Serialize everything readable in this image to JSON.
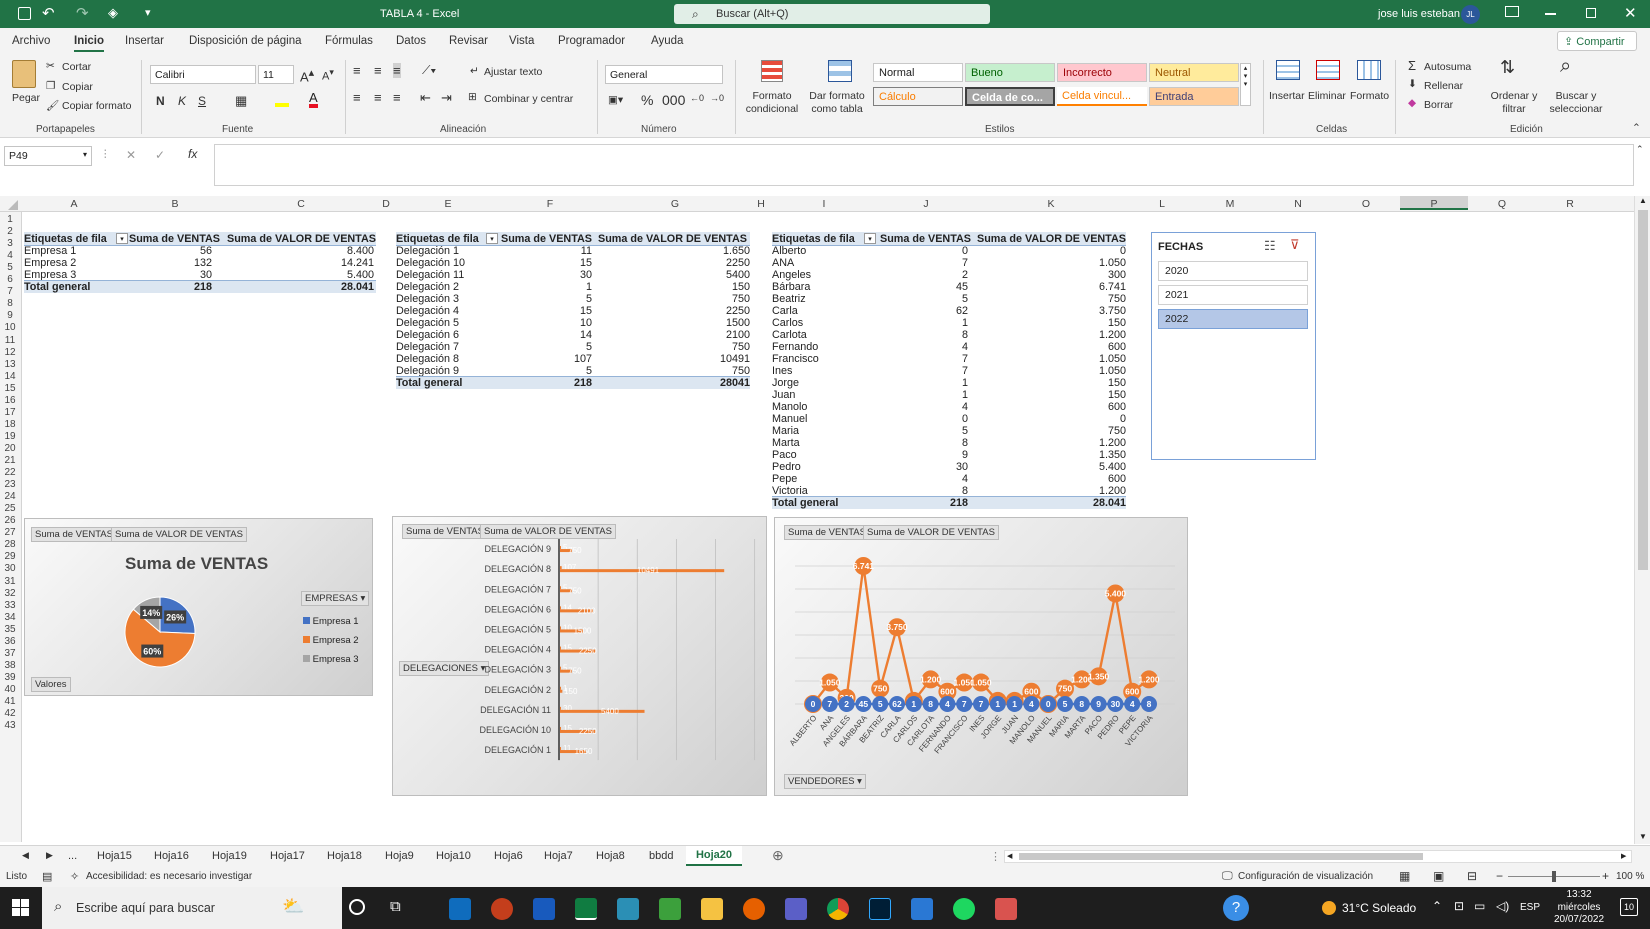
{
  "titlebar": {
    "file_title": "TABLA 4 - Excel",
    "search_placeholder": "Buscar (Alt+Q)",
    "user_name": "jose luis esteban",
    "user_initials": "JL"
  },
  "menu": [
    "Archivo",
    "Inicio",
    "Insertar",
    "Disposición de página",
    "Fórmulas",
    "Datos",
    "Revisar",
    "Vista",
    "Programador",
    "Ayuda"
  ],
  "share_label": "Compartir",
  "ribbon": {
    "clipboard": {
      "paste": "Pegar",
      "cut": "Cortar",
      "copy": "Copiar",
      "format_painter": "Copiar formato",
      "group": "Portapapeles"
    },
    "font": {
      "name": "Calibri",
      "size": "11",
      "group": "Fuente"
    },
    "alignment": {
      "wrap": "Ajustar texto",
      "merge": "Combinar y centrar",
      "group": "Alineación"
    },
    "number": {
      "format": "General",
      "group": "Número"
    },
    "styles": {
      "cond_format": "Formato condicional",
      "table_format": "Dar formato como tabla",
      "normal": "Normal",
      "good": "Bueno",
      "bad": "Incorrecto",
      "neutral": "Neutral",
      "calc": "Cálculo",
      "check": "Celda de co...",
      "linked": "Celda vincul...",
      "input": "Entrada",
      "group": "Estilos"
    },
    "cells": {
      "insert": "Insertar",
      "delete": "Eliminar",
      "format": "Formato",
      "group": "Celdas"
    },
    "editing": {
      "autosum": "Autosuma",
      "fill": "Rellenar",
      "clear": "Borrar",
      "sort": "Ordenar y filtrar",
      "find": "Buscar y seleccionar",
      "group": "Edición"
    }
  },
  "formula_bar": {
    "name_box": "P49",
    "formula": ""
  },
  "columns": [
    "A",
    "B",
    "C",
    "D",
    "E",
    "F",
    "G",
    "H",
    "I",
    "J",
    "K",
    "L",
    "M",
    "N",
    "O",
    "P",
    "Q",
    "R"
  ],
  "pivot1": {
    "headers": [
      "Etiquetas de fila",
      "Suma de VENTAS",
      "Suma de VALOR DE VENTAS"
    ],
    "rows": [
      [
        "Empresa 1",
        "56",
        "8.400"
      ],
      [
        "Empresa 2",
        "132",
        "14.241"
      ],
      [
        "Empresa 3",
        "30",
        "5.400"
      ]
    ],
    "total": [
      "Total general",
      "218",
      "28.041"
    ]
  },
  "pivot2": {
    "headers": [
      "Etiquetas de fila",
      "Suma de VENTAS",
      "Suma de VALOR DE VENTAS"
    ],
    "rows": [
      [
        "Delegación 1",
        "11",
        "1.650"
      ],
      [
        "Delegación 10",
        "15",
        "2250"
      ],
      [
        "Delegación 11",
        "30",
        "5400"
      ],
      [
        "Delegación 2",
        "1",
        "150"
      ],
      [
        "Delegación 3",
        "5",
        "750"
      ],
      [
        "Delegación 4",
        "15",
        "2250"
      ],
      [
        "Delegación 5",
        "10",
        "1500"
      ],
      [
        "Delegación 6",
        "14",
        "2100"
      ],
      [
        "Delegación 7",
        "5",
        "750"
      ],
      [
        "Delegación 8",
        "107",
        "10491"
      ],
      [
        "Delegación 9",
        "5",
        "750"
      ]
    ],
    "total": [
      "Total general",
      "218",
      "28041"
    ]
  },
  "pivot3": {
    "headers": [
      "Etiquetas de fila",
      "Suma de VENTAS",
      "Suma de VALOR DE VENTAS"
    ],
    "rows": [
      [
        "Alberto",
        "0",
        "0"
      ],
      [
        "ANA",
        "7",
        "1.050"
      ],
      [
        "Angeles",
        "2",
        "300"
      ],
      [
        "Bárbara",
        "45",
        "6.741"
      ],
      [
        "Beatriz",
        "5",
        "750"
      ],
      [
        "Carla",
        "62",
        "3.750"
      ],
      [
        "Carlos",
        "1",
        "150"
      ],
      [
        "Carlota",
        "8",
        "1.200"
      ],
      [
        "Fernando",
        "4",
        "600"
      ],
      [
        "Francisco",
        "7",
        "1.050"
      ],
      [
        "Ines",
        "7",
        "1.050"
      ],
      [
        "Jorge",
        "1",
        "150"
      ],
      [
        "Juan",
        "1",
        "150"
      ],
      [
        "Manolo",
        "4",
        "600"
      ],
      [
        "Manuel",
        "0",
        "0"
      ],
      [
        "Maria",
        "5",
        "750"
      ],
      [
        "Marta",
        "8",
        "1.200"
      ],
      [
        "Paco",
        "9",
        "1.350"
      ],
      [
        "Pedro",
        "30",
        "5.400"
      ],
      [
        "Pepe",
        "4",
        "600"
      ],
      [
        "Victoria",
        "8",
        "1.200"
      ]
    ],
    "total": [
      "Total general",
      "218",
      "28.041"
    ]
  },
  "slicer": {
    "title": "FECHAS",
    "items": [
      "2020",
      "2021",
      "2022"
    ],
    "selected": "2022"
  },
  "chart_data": [
    {
      "type": "pie",
      "title": "Suma de VENTAS",
      "buttons": [
        "Suma de VENTAS",
        "Suma de VALOR DE VENTAS"
      ],
      "legend_title": "EMPRESAS",
      "categories": [
        "Empresa 1",
        "Empresa 2",
        "Empresa 3"
      ],
      "values": [
        56,
        132,
        30
      ],
      "data_labels": [
        "26%",
        "60%",
        "14%"
      ],
      "colors": [
        "#4472c4",
        "#ed7d31",
        "#a5a5a5"
      ],
      "values_label": "Valores"
    },
    {
      "type": "bar",
      "orientation": "horizontal",
      "buttons": [
        "Suma de VENTAS",
        "Suma de VALOR DE VENTAS"
      ],
      "axis_field": "DELEGACIONES",
      "categories": [
        "DELEGACIÓN 9",
        "DELEGACIÓN 8",
        "DELEGACIÓN 7",
        "DELEGACIÓN 6",
        "DELEGACIÓN 5",
        "DELEGACIÓN 4",
        "DELEGACIÓN 3",
        "DELEGACIÓN 2",
        "DELEGACIÓN 11",
        "DELEGACIÓN 10",
        "DELEGACIÓN 1"
      ],
      "series": [
        {
          "values": [
            5,
            107,
            5,
            14,
            10,
            15,
            5,
            1,
            30,
            15,
            11
          ]
        },
        {
          "values": [
            750,
            10491,
            750,
            2100,
            1500,
            2250,
            750,
            150,
            5400,
            2250,
            1650
          ]
        }
      ],
      "colors": [
        "#ed7d31",
        "#ed7d31"
      ]
    },
    {
      "type": "line",
      "buttons": [
        "Suma de VENTAS",
        "Suma de VALOR DE VENTAS"
      ],
      "axis_field": "VENDEDORES",
      "categories": [
        "ALBERTO",
        "ANA",
        "ANGELES",
        "BÁRBARA",
        "BEATRIZ",
        "CARLA",
        "CARLOS",
        "CARLOTA",
        "FERNANDO",
        "FRANCISCO",
        "INES",
        "JORGE",
        "JUAN",
        "MANOLO",
        "MANUEL",
        "MARIA",
        "MARTA",
        "PACO",
        "PEDRO",
        "PEPE",
        "VICTORIA"
      ],
      "series": [
        {
          "values": [
            0,
            7,
            2,
            45,
            5,
            62,
            1,
            8,
            4,
            7,
            7,
            1,
            1,
            4,
            0,
            5,
            8,
            9,
            30,
            4,
            8
          ],
          "labels": [
            "0",
            "7",
            "2",
            "45",
            "5",
            "62",
            "1",
            "8",
            "4",
            "7",
            "7",
            "1",
            "1",
            "4",
            "0",
            "5",
            "8",
            "9",
            "30",
            "4",
            "8"
          ]
        },
        {
          "values": [
            0,
            1050,
            300,
            6741,
            750,
            3750,
            150,
            1200,
            600,
            1050,
            1050,
            150,
            150,
            600,
            0,
            750,
            1200,
            1350,
            5400,
            600,
            1200
          ],
          "labels": [
            "0",
            "1.050",
            "300",
            "6.741",
            "750",
            "3.750",
            "150",
            "1.200",
            "600",
            "1.050",
            "1.050",
            "150",
            "150",
            "600",
            "0",
            "750",
            "1.200",
            "1.350",
            "5.400",
            "600",
            "1.200"
          ]
        }
      ],
      "colors": [
        "#4472c4",
        "#ed7d31"
      ]
    }
  ],
  "sheets": [
    "...",
    "Hoja15",
    "Hoja16",
    "Hoja19",
    "Hoja17",
    "Hoja18",
    "Hoja9",
    "Hoja10",
    "Hoja6",
    "Hoja7",
    "Hoja8",
    "bbdd",
    "Hoja20"
  ],
  "active_sheet": "Hoja20",
  "status": {
    "ready": "Listo",
    "accessibility": "Accesibilidad: es necesario investigar",
    "display_settings": "Configuración de visualización",
    "zoom": "100 %"
  },
  "taskbar": {
    "search_placeholder": "Escribe aquí para buscar",
    "weather": "31°C Soleado",
    "lang": "ESP",
    "time": "13:32",
    "day": "miércoles",
    "date": "20/07/2022",
    "notif": "10"
  }
}
